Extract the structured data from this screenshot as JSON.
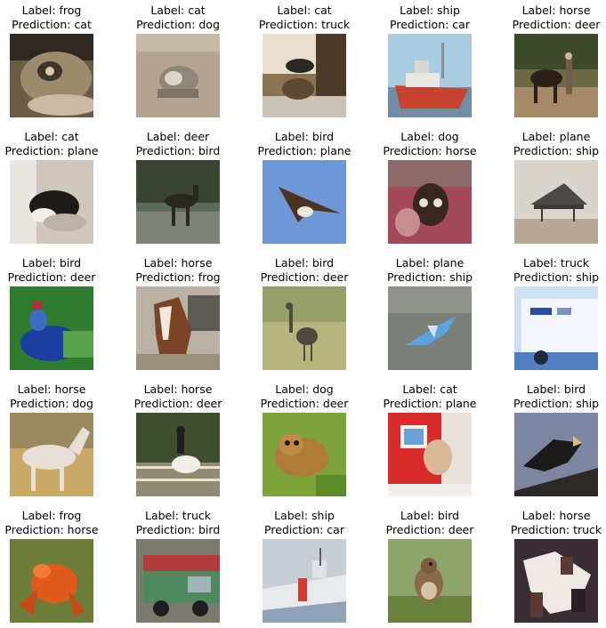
{
  "chart_data": {
    "type": "image-grid",
    "layout": "5x5",
    "panels": [
      {
        "label": "Label: frog",
        "prediction": "Prediction: cat",
        "subject": "frog"
      },
      {
        "label": "Label: cat",
        "prediction": "Prediction: dog",
        "subject": "cat"
      },
      {
        "label": "Label: cat",
        "prediction": "Prediction: truck",
        "subject": "cat"
      },
      {
        "label": "Label: ship",
        "prediction": "Prediction: car",
        "subject": "ship"
      },
      {
        "label": "Label: horse",
        "prediction": "Prediction: deer",
        "subject": "horse"
      },
      {
        "label": "Label: cat",
        "prediction": "Prediction: plane",
        "subject": "cat"
      },
      {
        "label": "Label: deer",
        "prediction": "Prediction: bird",
        "subject": "deer"
      },
      {
        "label": "Label: bird",
        "prediction": "Prediction: plane",
        "subject": "bird"
      },
      {
        "label": "Label: dog",
        "prediction": "Prediction: horse",
        "subject": "dog"
      },
      {
        "label": "Label: plane",
        "prediction": "Prediction: ship",
        "subject": "plane"
      },
      {
        "label": "Label: bird",
        "prediction": "Prediction: deer",
        "subject": "bird"
      },
      {
        "label": "Label: horse",
        "prediction": "Prediction: frog",
        "subject": "horse"
      },
      {
        "label": "Label: bird",
        "prediction": "Prediction: deer",
        "subject": "bird"
      },
      {
        "label": "Label: plane",
        "prediction": "Prediction: ship",
        "subject": "plane"
      },
      {
        "label": "Label: truck",
        "prediction": "Prediction: ship",
        "subject": "truck"
      },
      {
        "label": "Label: horse",
        "prediction": "Prediction: dog",
        "subject": "horse"
      },
      {
        "label": "Label: horse",
        "prediction": "Prediction: deer",
        "subject": "horse"
      },
      {
        "label": "Label: dog",
        "prediction": "Prediction: deer",
        "subject": "dog"
      },
      {
        "label": "Label: cat",
        "prediction": "Prediction: plane",
        "subject": "cat"
      },
      {
        "label": "Label: bird",
        "prediction": "Prediction: ship",
        "subject": "bird"
      },
      {
        "label": "Label: frog",
        "prediction": "Prediction: horse",
        "subject": "frog"
      },
      {
        "label": "Label: truck",
        "prediction": "Prediction: bird",
        "subject": "truck"
      },
      {
        "label": "Label: ship",
        "prediction": "Prediction: car",
        "subject": "ship"
      },
      {
        "label": "Label: bird",
        "prediction": "Prediction: deer",
        "subject": "bird"
      },
      {
        "label": "Label: horse",
        "prediction": "Prediction: truck",
        "subject": "horse"
      }
    ]
  }
}
